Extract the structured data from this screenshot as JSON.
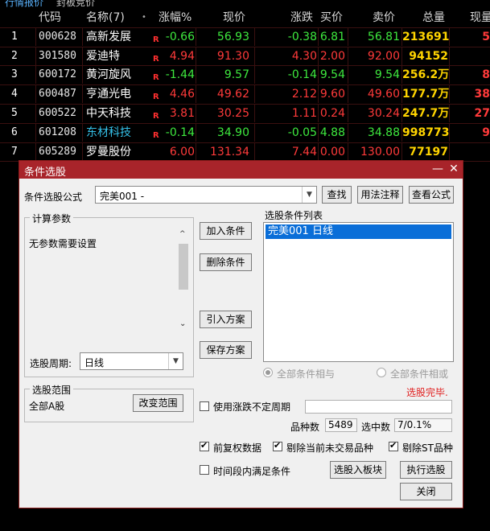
{
  "tabs": [
    "行情报价",
    "封板竞价"
  ],
  "table": {
    "headers": {
      "index": "",
      "code": "代码",
      "name": "名称(7)",
      "dot": "•",
      "pct": "涨幅%",
      "price": "现价",
      "chg": "涨跌",
      "bid": "买价",
      "ask": "卖价",
      "vol": "总量",
      "cur": "现量"
    },
    "rows": [
      {
        "i": "1",
        "code": "000628",
        "name": "高新发展",
        "r": "R",
        "pct": "-0.66",
        "price": "56.93",
        "chg": "-0.38",
        "bid": "6.81",
        "ask": "56.81",
        "vol": "213691",
        "cur": "5"
      },
      {
        "i": "2",
        "code": "301580",
        "name": "爱迪特",
        "r": "R",
        "pct": "4.94",
        "price": "91.30",
        "chg": "4.30",
        "bid": "2.00",
        "ask": "92.00",
        "vol": "94152",
        "cur": ""
      },
      {
        "i": "3",
        "code": "600172",
        "name": "黄河旋风",
        "r": "R",
        "pct": "-1.44",
        "price": "9.57",
        "chg": "-0.14",
        "bid": "9.54",
        "ask": "9.54",
        "vol": "256.2万",
        "cur": "8"
      },
      {
        "i": "4",
        "code": "600487",
        "name": "亨通光电",
        "r": "R",
        "pct": "4.46",
        "price": "49.62",
        "chg": "2.12",
        "bid": "9.60",
        "ask": "49.60",
        "vol": "177.7万",
        "cur": "38"
      },
      {
        "i": "5",
        "code": "600522",
        "name": "中天科技",
        "r": "R",
        "pct": "3.81",
        "price": "30.25",
        "chg": "1.11",
        "bid": "0.24",
        "ask": "30.24",
        "vol": "247.7万",
        "cur": "27"
      },
      {
        "i": "6",
        "code": "601208",
        "name": "东材科技",
        "r": "R",
        "pct": "-0.14",
        "price": "34.90",
        "chg": "-0.05",
        "bid": "4.88",
        "ask": "34.88",
        "vol": "998773",
        "cur": "9"
      },
      {
        "i": "7",
        "code": "605289",
        "name": "罗曼股份",
        "r": "",
        "pct": "6.00",
        "price": "131.34",
        "chg": "7.44",
        "bid": "0.00",
        "ask": "130.00",
        "vol": "77197",
        "cur": ""
      }
    ]
  },
  "dialog": {
    "title": "条件选股",
    "formula_label": "条件选股公式",
    "formula_value": "完美001  -",
    "find_btn": "查找",
    "usage_btn": "用法注释",
    "view_btn": "查看公式",
    "params_group": "计算参数",
    "params_text": "无参数需要设置",
    "add_btn": "加入条件",
    "del_btn": "删除条件",
    "import_btn": "引入方案",
    "save_btn": "保存方案",
    "list_label": "选股条件列表",
    "list_item": "完美001  日线",
    "period_label": "选股周期:",
    "period_value": "日线",
    "and_label": "全部条件相与",
    "or_label": "全部条件相或",
    "status": "选股完毕.",
    "range_group": "选股范围",
    "range_text": "全部A股",
    "change_range_btn": "改变范围",
    "use_period_label": "使用涨跌不定周期",
    "count_label": "品种数",
    "count_value": "5489",
    "selected_label": "选中数",
    "selected_value": "7/0.1%",
    "prior_label": "前复权数据",
    "exclude_untraded_label": "剔除当前未交易品种",
    "exclude_st_label": "剔除ST品种",
    "time_label": "时间段内满足条件",
    "to_block_btn": "选股入板块",
    "run_btn": "执行选股",
    "close_btn": "关闭"
  },
  "colors": {
    "accent": "#a8242a",
    "up": "#ff3a3a",
    "down": "#3ee83e",
    "selection": "#0a6ed8"
  }
}
